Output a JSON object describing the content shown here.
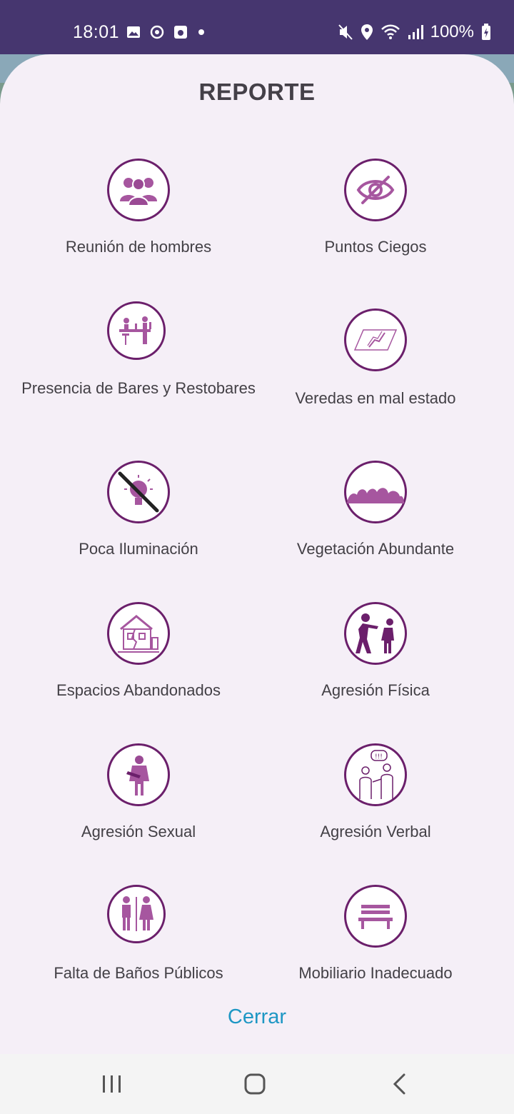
{
  "status_bar": {
    "time": "18:01",
    "battery": "100%",
    "left_icons": [
      "image-icon",
      "sync-icon",
      "media-icon",
      "dot-icon"
    ],
    "right_icons": [
      "mute-icon",
      "location-icon",
      "wifi-icon",
      "signal-icon",
      "battery-charging-icon"
    ]
  },
  "sheet": {
    "title": "REPORTE",
    "items": [
      {
        "label": "Reunión de hombres",
        "icon": "group-of-men-icon"
      },
      {
        "label": "Puntos Ciegos",
        "icon": "eye-slash-icon"
      },
      {
        "label": "Presencia de Bares y Restobares",
        "icon": "bar-icon"
      },
      {
        "label": "Veredas en mal estado",
        "icon": "broken-sidewalk-icon"
      },
      {
        "label": "Poca Iluminación",
        "icon": "no-light-bulb-icon"
      },
      {
        "label": "Vegetación Abundante",
        "icon": "bushes-icon"
      },
      {
        "label": "Espacios Abandonados",
        "icon": "abandoned-building-icon"
      },
      {
        "label": "Agresión Física",
        "icon": "physical-aggression-icon"
      },
      {
        "label": "Agresión Sexual",
        "icon": "sexual-aggression-icon"
      },
      {
        "label": "Agresión Verbal",
        "icon": "verbal-aggression-icon"
      },
      {
        "label": "Falta de Baños Públicos",
        "icon": "restroom-icon"
      },
      {
        "label": "Mobiliario Inadecuado",
        "icon": "bench-icon"
      }
    ],
    "close_label": "Cerrar"
  },
  "nav_bar": {
    "recents": "recents-icon",
    "home": "home-icon",
    "back": "back-icon"
  },
  "colors": {
    "status_bar": "#46366f",
    "sheet_bg": "#f5eff7",
    "icon_accent": "#6b1f6b",
    "icon_fill": "#a6569f",
    "close_text": "#1e97c4"
  }
}
